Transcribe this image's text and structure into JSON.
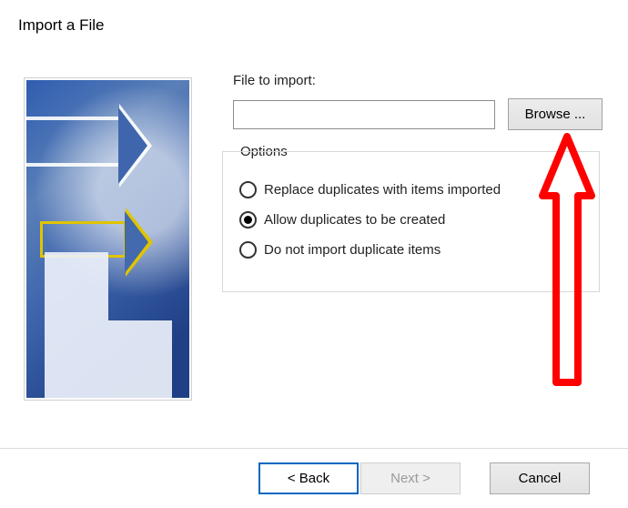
{
  "title": "Import a File",
  "fileSection": {
    "label": "File to import:",
    "value": "",
    "placeholder": "",
    "browseLabel": "Browse ..."
  },
  "options": {
    "legend": "Options",
    "items": [
      {
        "label": "Replace duplicates with items imported",
        "selected": false
      },
      {
        "label": "Allow duplicates to be created",
        "selected": true
      },
      {
        "label": "Do not import duplicate items",
        "selected": false
      }
    ]
  },
  "nav": {
    "back": "<  Back",
    "next": "Next  >",
    "cancel": "Cancel",
    "nextEnabled": false
  },
  "annotation": {
    "color": "#ff0000"
  }
}
